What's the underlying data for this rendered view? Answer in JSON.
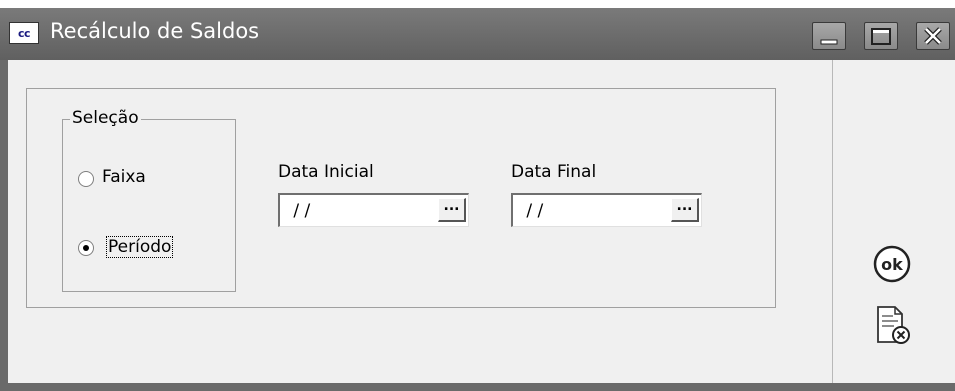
{
  "window": {
    "icon_text": "cc",
    "title": "Recálculo de Saldos"
  },
  "selection": {
    "legend": "Seleção",
    "options": [
      {
        "label": "Faixa",
        "checked": false
      },
      {
        "label": "Período",
        "checked": true
      }
    ]
  },
  "fields": {
    "start_date": {
      "label": "Data Inicial",
      "value": " / /"
    },
    "end_date": {
      "label": "Data Final",
      "value": " / /"
    },
    "ellipsis": "..."
  },
  "buttons": {
    "ok_icon": "ok-icon",
    "cancel_icon": "cancel-document-icon"
  }
}
